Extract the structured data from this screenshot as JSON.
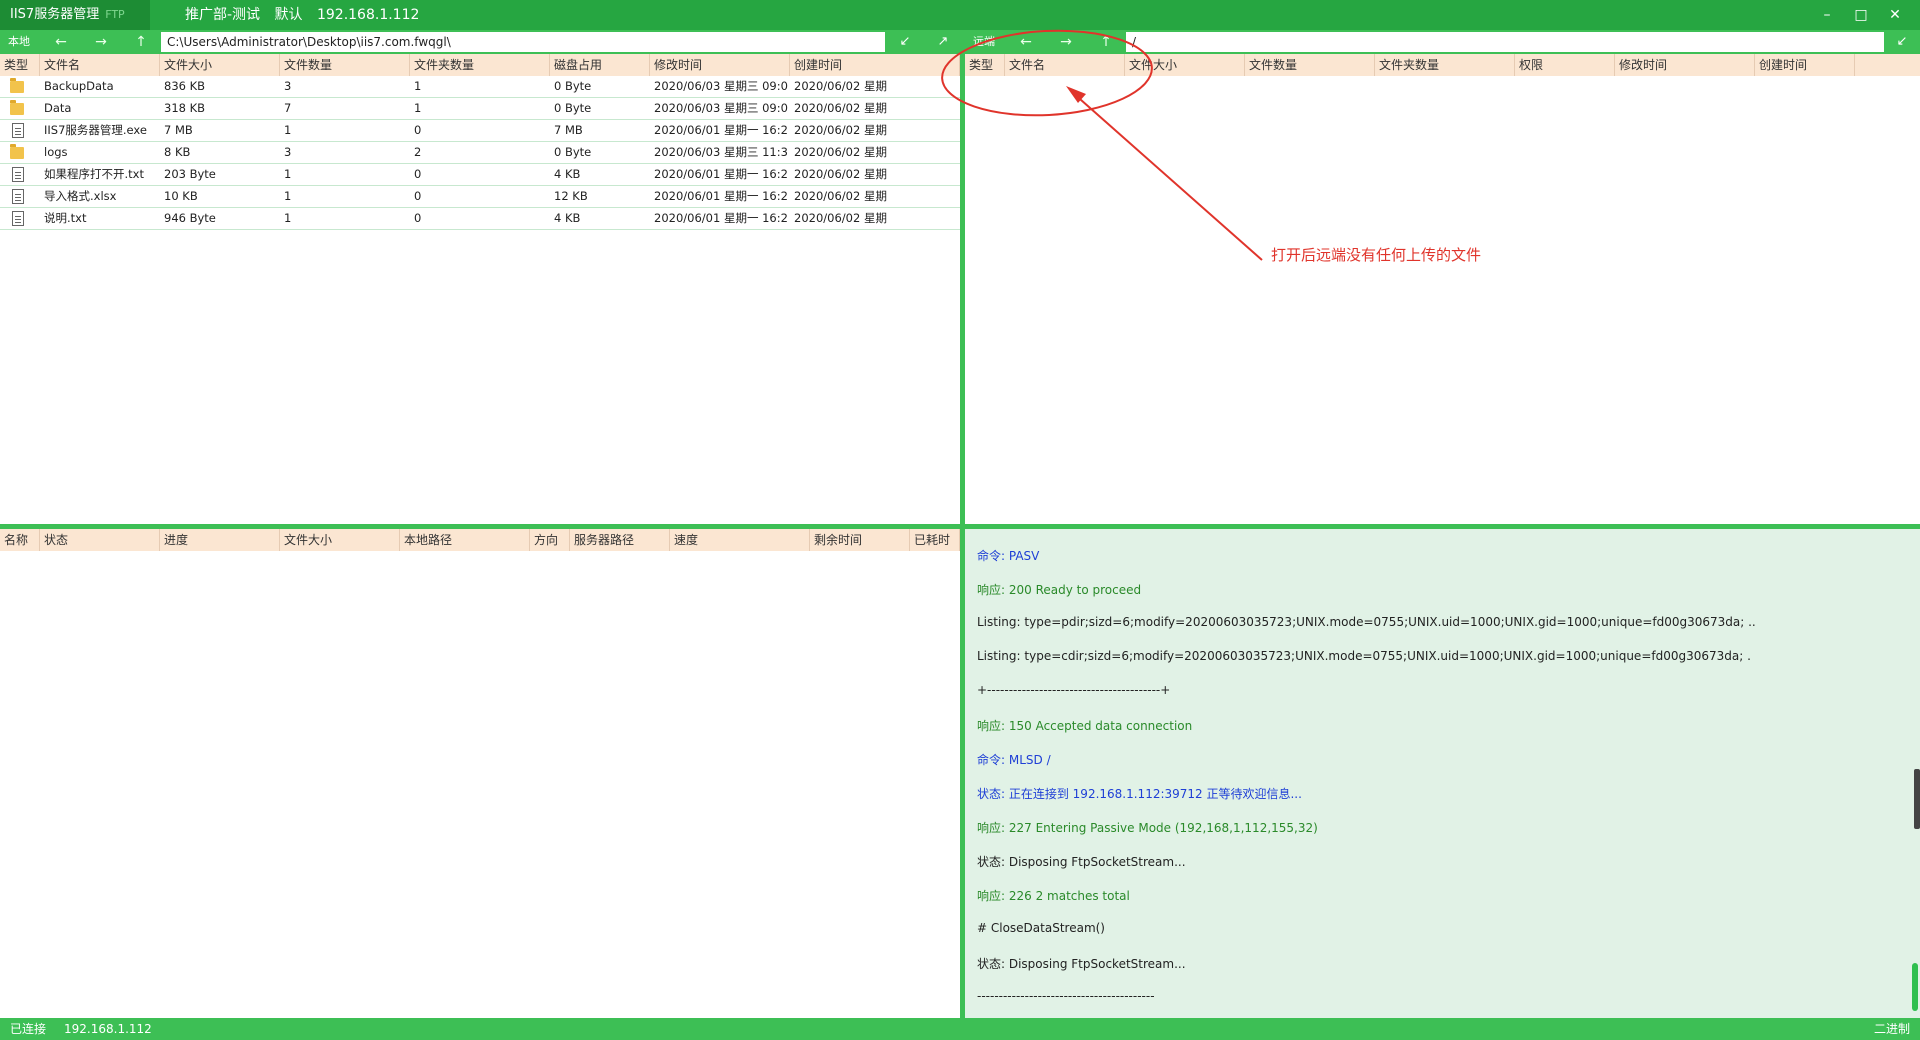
{
  "titlebar": {
    "app_name": "IIS7服务器管理",
    "app_tag": "FTP",
    "conn_dept": "推广部-测试",
    "conn_group": "默认",
    "conn_ip": "192.168.1.112",
    "min": "–",
    "max": "□",
    "close": "✕"
  },
  "local": {
    "label": "本地",
    "path": "C:\\Users\\Administrator\\Desktop\\iis7.com.fwqgl\\",
    "columns": [
      "类型",
      "文件名",
      "文件大小",
      "文件数量",
      "文件夹数量",
      "磁盘占用",
      "修改时间",
      "创建时间"
    ],
    "rows": [
      {
        "icon": "folder-icon",
        "name": "BackupData",
        "size": "836 KB",
        "files": "3",
        "folders": "1",
        "disk": "0 Byte",
        "modified": "2020/06/03 星期三 09:0",
        "created": "2020/06/02 星期"
      },
      {
        "icon": "folder-icon",
        "name": "Data",
        "size": "318 KB",
        "files": "7",
        "folders": "1",
        "disk": "0 Byte",
        "modified": "2020/06/03 星期三 09:0",
        "created": "2020/06/02 星期"
      },
      {
        "icon": "file-icon",
        "name": "IIS7服务器管理.exe",
        "size": "7 MB",
        "files": "1",
        "folders": "0",
        "disk": "7 MB",
        "modified": "2020/06/01 星期一 16:2",
        "created": "2020/06/02 星期"
      },
      {
        "icon": "folder-icon",
        "name": "logs",
        "size": "8 KB",
        "files": "3",
        "folders": "2",
        "disk": "0 Byte",
        "modified": "2020/06/03 星期三 11:3",
        "created": "2020/06/02 星期"
      },
      {
        "icon": "file-icon",
        "name": "如果程序打不开.txt",
        "size": "203 Byte",
        "files": "1",
        "folders": "0",
        "disk": "4 KB",
        "modified": "2020/06/01 星期一 16:2",
        "created": "2020/06/02 星期"
      },
      {
        "icon": "file-icon",
        "name": "导入格式.xlsx",
        "size": "10 KB",
        "files": "1",
        "folders": "0",
        "disk": "12 KB",
        "modified": "2020/06/01 星期一 16:2",
        "created": "2020/06/02 星期"
      },
      {
        "icon": "file-icon",
        "name": "说明.txt",
        "size": "946 Byte",
        "files": "1",
        "folders": "0",
        "disk": "4 KB",
        "modified": "2020/06/01 星期一 16:2",
        "created": "2020/06/02 星期"
      }
    ]
  },
  "remote": {
    "label": "远端",
    "path": "/",
    "columns": [
      "类型",
      "文件名",
      "文件大小",
      "文件数量",
      "文件夹数量",
      "权限",
      "修改时间",
      "创建时间"
    ]
  },
  "transfer": {
    "columns": [
      "名称",
      "状态",
      "进度",
      "文件大小",
      "本地路径",
      "方向",
      "服务器路径",
      "速度",
      "剩余时间",
      "已耗时"
    ]
  },
  "log": [
    {
      "type": "blue",
      "text": "命令:  PASV"
    },
    {
      "type": "green",
      "text": "响应: 200 Ready to proceed"
    },
    {
      "type": "black",
      "text": "Listing:  type=pdir;sizd=6;modify=20200603035723;UNIX.mode=0755;UNIX.uid=1000;UNIX.gid=1000;unique=fd00g30673da; .."
    },
    {
      "type": "black",
      "text": "Listing:  type=cdir;sizd=6;modify=20200603035723;UNIX.mode=0755;UNIX.uid=1000;UNIX.gid=1000;unique=fd00g30673da; ."
    },
    {
      "type": "black",
      "text": "+----------------------------------------+"
    },
    {
      "type": "green",
      "text": "响应: 150 Accepted data connection"
    },
    {
      "type": "blue",
      "text": "命令:  MLSD /"
    },
    {
      "type": "blue",
      "text": "状态:   正在连接到  192.168.1.112:39712  正等待欢迎信息..."
    },
    {
      "type": "green",
      "text": "响应: 227 Entering Passive Mode (192,168,1,112,155,32)"
    },
    {
      "type": "black",
      "text": "状态:   Disposing FtpSocketStream..."
    },
    {
      "type": "green",
      "text": "响应: 226 2 matches total"
    },
    {
      "type": "black",
      "text": "# CloseDataStream()"
    },
    {
      "type": "black",
      "text": "状态:   Disposing FtpSocketStream..."
    },
    {
      "type": "black",
      "text": "-----------------------------------------"
    }
  ],
  "status": {
    "state": "已连接",
    "ip": "192.168.1.112",
    "mode": "二进制"
  },
  "annotation": {
    "text": "打开后远端没有任何上传的文件",
    "color": "#e0342b"
  },
  "colors": {
    "title_green": "#26a641",
    "bar_green": "#3dbf55",
    "header_bg": "#fbe6d2",
    "log_bg": "#e1f2e6"
  }
}
